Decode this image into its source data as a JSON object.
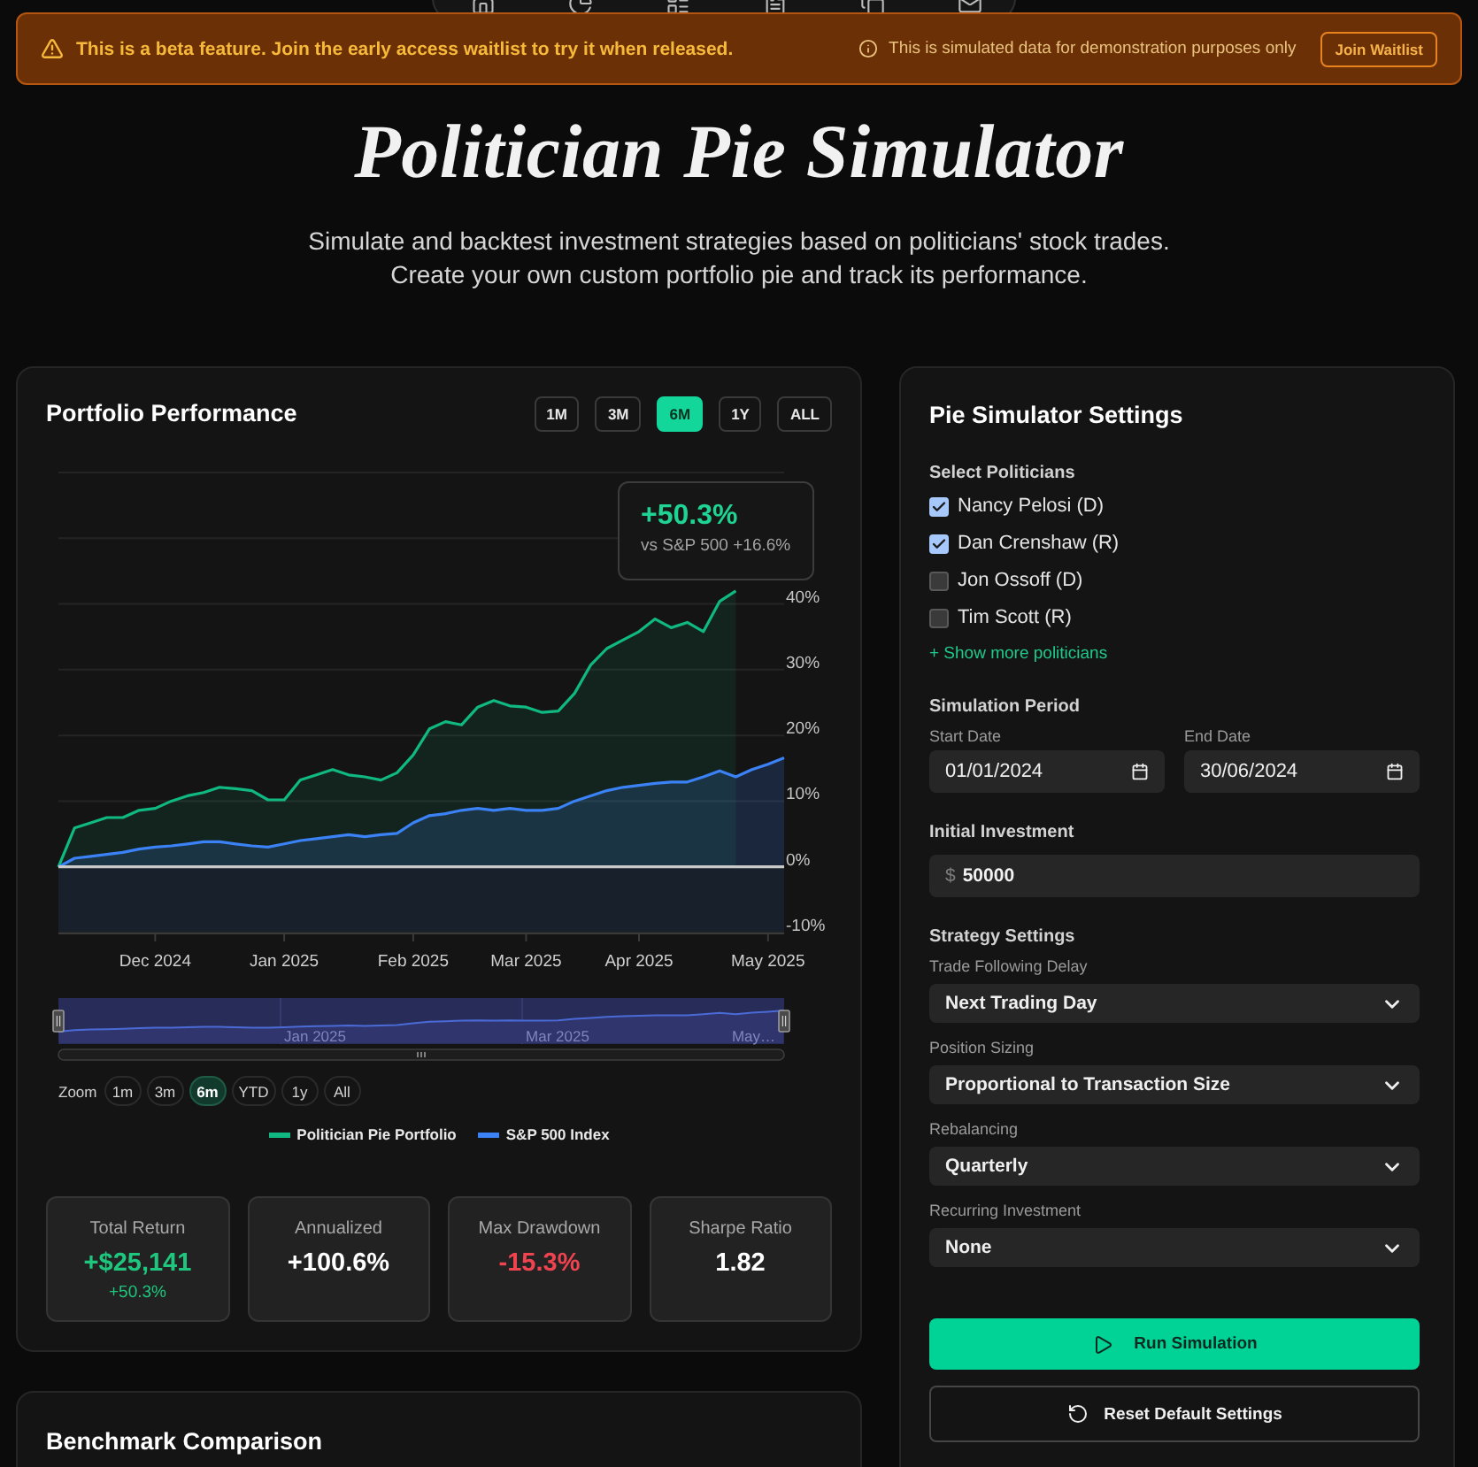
{
  "banner": {
    "message": "This is a beta feature. Join the early access waitlist to try it when released.",
    "notice": "This is simulated data for demonstration purposes only",
    "button": "Join Waitlist"
  },
  "header": {
    "title": "Politician Pie Simulator",
    "subtitle": [
      "Simulate and backtest investment strategies based on politicians' stock trades.",
      "Create your own custom portfolio pie and track its performance."
    ]
  },
  "performance": {
    "title": "Portfolio Performance",
    "ranges": [
      {
        "label": "1M",
        "selected": false
      },
      {
        "label": "3M",
        "selected": false
      },
      {
        "label": "6M",
        "selected": true
      },
      {
        "label": "1Y",
        "selected": false
      },
      {
        "label": "ALL",
        "selected": false
      }
    ],
    "chart_data": {
      "type": "area",
      "categories": [
        null,
        null,
        null,
        null,
        null,
        null,
        "Dec 2024",
        null,
        null,
        null,
        null,
        null,
        null,
        null,
        "Jan 2025",
        null,
        null,
        null,
        null,
        null,
        null,
        null,
        "Feb 2025",
        null,
        null,
        null,
        null,
        null,
        null,
        "Mar 2025",
        null,
        null,
        null,
        null,
        null,
        null,
        "Apr 2025",
        null,
        null,
        null,
        null,
        null,
        null,
        null,
        "May 2025",
        null
      ],
      "ylim": [
        -10,
        60
      ],
      "yticks": [
        {
          "value": -10,
          "label": "-10%"
        },
        {
          "value": 0,
          "label": "0%"
        },
        {
          "value": 10,
          "label": "10%"
        },
        {
          "value": 20,
          "label": "20%"
        },
        {
          "value": 30,
          "label": "30%"
        },
        {
          "value": 40,
          "label": "40%"
        }
      ],
      "grid": true,
      "series": [
        {
          "name": "Politician Pie Portfolio",
          "color": "#10b981",
          "values": [
            0,
            5.9,
            6.7,
            7.5,
            7.5,
            8.6,
            8.9,
            10.0,
            10.8,
            11.3,
            12.1,
            11.9,
            11.6,
            10.2,
            10.2,
            13.2,
            14.0,
            14.8,
            14.0,
            13.7,
            13.2,
            14.3,
            17.0,
            21.0,
            22.1,
            21.6,
            24.3,
            25.3,
            24.5,
            24.3,
            23.5,
            23.7,
            26.4,
            30.7,
            33.2,
            34.5,
            35.8,
            37.7,
            36.4,
            37.2,
            35.8,
            40.4,
            42.0,
            null,
            null,
            null
          ]
        },
        {
          "name": "S&P 500 Index",
          "color": "#3b82f6",
          "values": [
            0,
            1.3,
            1.6,
            1.9,
            2.2,
            2.7,
            3.0,
            3.2,
            3.5,
            3.8,
            3.8,
            3.5,
            3.2,
            3.0,
            3.5,
            4.0,
            4.3,
            4.6,
            4.9,
            4.6,
            4.9,
            5.1,
            6.7,
            7.8,
            8.1,
            8.6,
            8.9,
            8.6,
            8.9,
            8.6,
            8.6,
            8.9,
            10.0,
            10.8,
            11.6,
            12.1,
            12.4,
            12.7,
            12.9,
            12.9,
            13.7,
            14.6,
            13.7,
            14.8,
            15.6,
            16.6
          ]
        }
      ]
    },
    "tooltip": {
      "value": "+50.3%",
      "comparison": "vs S&P 500 +16.6%"
    },
    "navigator": {
      "labels": [
        "Jan 2025",
        "Mar 2025",
        "May…"
      ]
    },
    "zoom": {
      "label": "Zoom",
      "options": [
        {
          "label": "1m",
          "selected": false
        },
        {
          "label": "3m",
          "selected": false
        },
        {
          "label": "6m",
          "selected": true
        },
        {
          "label": "YTD",
          "selected": false
        },
        {
          "label": "1y",
          "selected": false
        },
        {
          "label": "All",
          "selected": false
        }
      ]
    },
    "stats": [
      {
        "label": "Total Return",
        "value": "+$25,141",
        "sub": "+50.3%",
        "color": "#1fc77e"
      },
      {
        "label": "Annualized",
        "value": "+100.6%",
        "color": "#ffffff"
      },
      {
        "label": "Max Drawdown",
        "value": "-15.3%",
        "color": "#ef4450"
      },
      {
        "label": "Sharpe Ratio",
        "value": "1.82",
        "color": "#ffffff"
      }
    ]
  },
  "benchmark": {
    "title": "Benchmark Comparison"
  },
  "settings": {
    "title": "Pie Simulator Settings",
    "politicians": {
      "label": "Select Politicians",
      "items": [
        {
          "name": "Nancy Pelosi (D)",
          "checked": true
        },
        {
          "name": "Dan Crenshaw (R)",
          "checked": true
        },
        {
          "name": "Jon Ossoff (D)",
          "checked": false
        },
        {
          "name": "Tim Scott (R)",
          "checked": false
        }
      ],
      "more": "+ Show more politicians"
    },
    "period": {
      "label": "Simulation Period",
      "start": {
        "label": "Start Date",
        "value": "01/01/2024"
      },
      "end": {
        "label": "End Date",
        "value": "30/06/2024"
      }
    },
    "investment": {
      "label": "Initial Investment",
      "currency": "$",
      "value": "50000"
    },
    "strategy": {
      "label": "Strategy Settings",
      "fields": [
        {
          "label": "Trade Following Delay",
          "value": "Next Trading Day"
        },
        {
          "label": "Position Sizing",
          "value": "Proportional to Transaction Size"
        },
        {
          "label": "Rebalancing",
          "value": "Quarterly"
        },
        {
          "label": "Recurring Investment",
          "value": "None"
        }
      ]
    },
    "actions": {
      "run": "Run Simulation",
      "reset": "Reset Default Settings"
    }
  }
}
